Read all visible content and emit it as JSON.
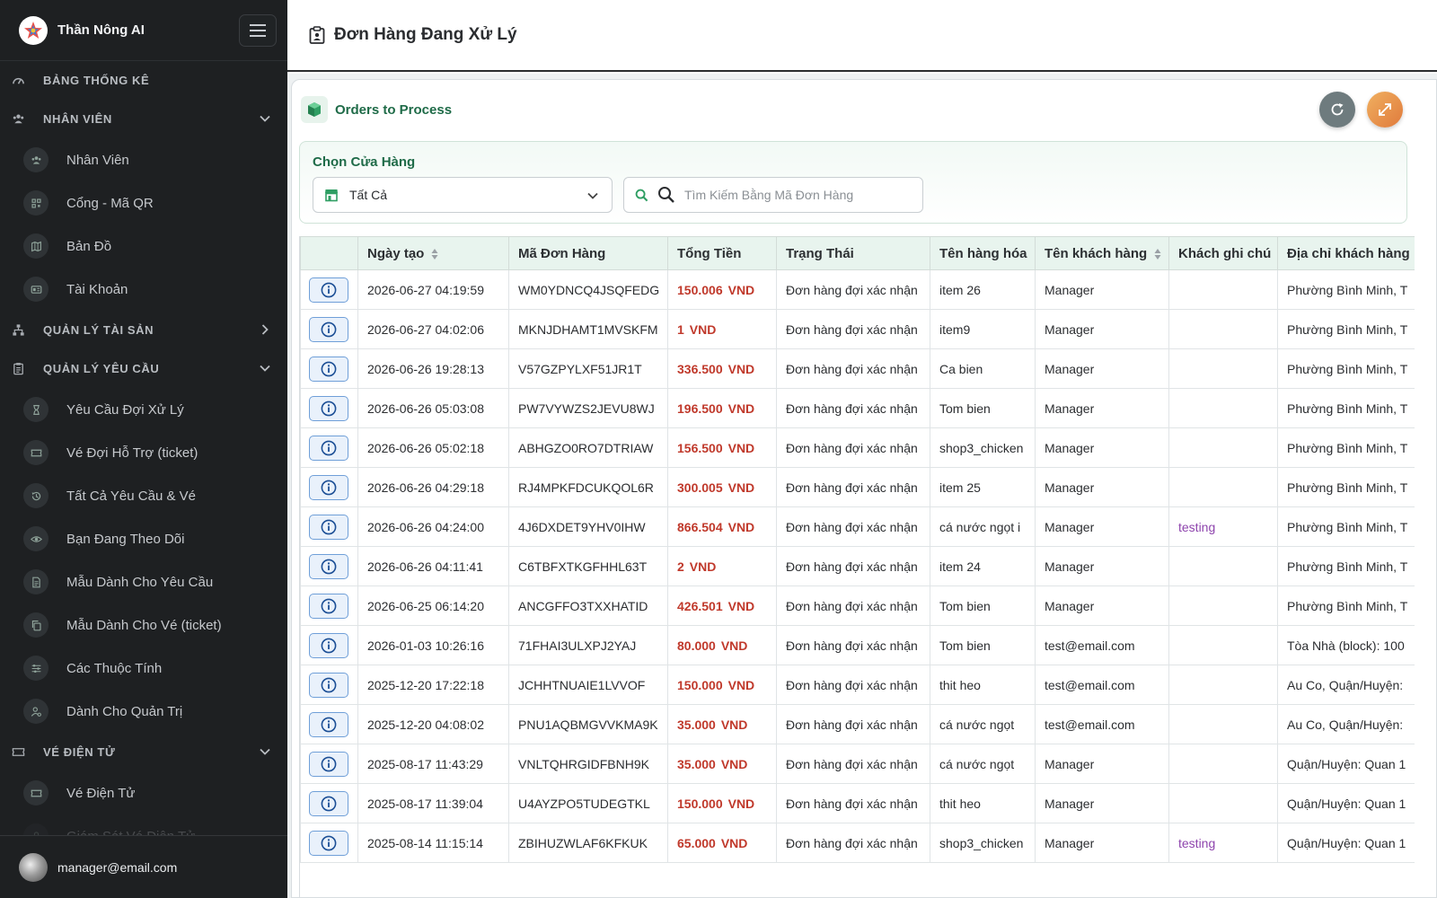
{
  "brand": {
    "name": "Thần Nông AI"
  },
  "sidebar": {
    "sections": [
      {
        "label": "BẢNG THỐNG KÊ",
        "icon": "gauge-icon",
        "chevron": "none",
        "items": []
      },
      {
        "label": "NHÂN VIÊN",
        "icon": "users-icon",
        "chevron": "down",
        "items": [
          {
            "label": "Nhân Viên",
            "icon": "users-icon"
          },
          {
            "label": "Cổng - Mã QR",
            "icon": "qr-icon"
          },
          {
            "label": "Bản Đồ",
            "icon": "map-icon"
          },
          {
            "label": "Tài Khoản",
            "icon": "id-card-icon"
          }
        ]
      },
      {
        "label": "QUẢN LÝ TÀI SẢN",
        "icon": "sitemap-icon",
        "chevron": "right",
        "items": []
      },
      {
        "label": "QUẢN LÝ YÊU CẦU",
        "icon": "clipboard-icon",
        "chevron": "down",
        "items": [
          {
            "label": "Yêu Cầu Đợi Xử Lý",
            "icon": "hourglass-icon"
          },
          {
            "label": "Vé Đợi Hỗ Trợ (ticket)",
            "icon": "ticket-icon"
          },
          {
            "label": "Tất Cả Yêu Cầu & Vé",
            "icon": "history-icon"
          },
          {
            "label": "Bạn Đang Theo Dõi",
            "icon": "eye-icon"
          },
          {
            "label": "Mẫu Dành Cho Yêu Cầu",
            "icon": "file-icon"
          },
          {
            "label": "Mẫu Dành Cho Vé (ticket)",
            "icon": "copy-icon"
          },
          {
            "label": "Các Thuộc Tính",
            "icon": "sliders-icon"
          },
          {
            "label": "Dành Cho Quản Trị",
            "icon": "user-gear-icon"
          }
        ]
      },
      {
        "label": "VÉ ĐIỆN TỬ",
        "icon": "ticket-icon",
        "chevron": "down",
        "items": [
          {
            "label": "Vé Điện Tử",
            "icon": "ticket-icon"
          },
          {
            "label": "Giám Sát Vé Điện Tử",
            "icon": "user-icon"
          }
        ]
      }
    ],
    "user_email": "manager@email.com"
  },
  "header": {
    "title": "Đơn Hàng Đang Xử Lý"
  },
  "card": {
    "title": "Orders to Process",
    "filter_label": "Chọn Cửa Hàng",
    "store_value": "Tất Cả",
    "search_placeholder": "Tìm Kiếm Bằng Mã Đơn Hàng"
  },
  "table": {
    "columns": [
      "",
      "Ngày tạo",
      "Mã Đơn Hàng",
      "Tổng Tiền",
      "Trạng Thái",
      "Tên hàng hóa",
      "Tên khách hàng",
      "Khách ghi chú",
      "Địa chỉ khách hàng"
    ],
    "currency": "VND",
    "rows": [
      {
        "date": "2026-06-27 04:19:59",
        "code": "WM0YDNCQ4JSQFEDG",
        "amount": "150.006",
        "status": "Đơn hàng đợi xác nhận",
        "product": "item 26",
        "customer": "Manager",
        "note": "",
        "address": "Phường Bình Minh, T"
      },
      {
        "date": "2026-06-27 04:02:06",
        "code": "MKNJDHAMT1MVSKFM",
        "amount": "1",
        "status": "Đơn hàng đợi xác nhận",
        "product": "item9",
        "customer": "Manager",
        "note": "",
        "address": "Phường Bình Minh, T"
      },
      {
        "date": "2026-06-26 19:28:13",
        "code": "V57GZPYLXF51JR1T",
        "amount": "336.500",
        "status": "Đơn hàng đợi xác nhận",
        "product": "Ca bien",
        "customer": "Manager",
        "note": "",
        "address": "Phường Bình Minh, T"
      },
      {
        "date": "2026-06-26 05:03:08",
        "code": "PW7VYWZS2JEVU8WJ",
        "amount": "196.500",
        "status": "Đơn hàng đợi xác nhận",
        "product": "Tom bien",
        "customer": "Manager",
        "note": "",
        "address": "Phường Bình Minh, T"
      },
      {
        "date": "2026-06-26 05:02:18",
        "code": "ABHGZO0RO7DTRIAW",
        "amount": "156.500",
        "status": "Đơn hàng đợi xác nhận",
        "product": "shop3_chicken",
        "customer": "Manager",
        "note": "",
        "address": "Phường Bình Minh, T"
      },
      {
        "date": "2026-06-26 04:29:18",
        "code": "RJ4MPKFDCUKQOL6R",
        "amount": "300.005",
        "status": "Đơn hàng đợi xác nhận",
        "product": "item 25",
        "customer": "Manager",
        "note": "",
        "address": "Phường Bình Minh, T"
      },
      {
        "date": "2026-06-26 04:24:00",
        "code": "4J6DXDET9YHV0IHW",
        "amount": "866.504",
        "status": "Đơn hàng đợi xác nhận",
        "product": "cá nước ngọt i",
        "customer": "Manager",
        "note": "testing",
        "address": "Phường Bình Minh, T"
      },
      {
        "date": "2026-06-26 04:11:41",
        "code": "C6TBFXTKGFHHL63T",
        "amount": "2",
        "status": "Đơn hàng đợi xác nhận",
        "product": "item 24",
        "customer": "Manager",
        "note": "",
        "address": "Phường Bình Minh, T"
      },
      {
        "date": "2026-06-25 06:14:20",
        "code": "ANCGFFO3TXXHATID",
        "amount": "426.501",
        "status": "Đơn hàng đợi xác nhận",
        "product": "Tom bien",
        "customer": "Manager",
        "note": "",
        "address": "Phường Bình Minh, T"
      },
      {
        "date": "2026-01-03 10:26:16",
        "code": "71FHAI3ULXPJ2YAJ",
        "amount": "80.000",
        "status": "Đơn hàng đợi xác nhận",
        "product": "Tom bien",
        "customer": "test@email.com",
        "note": "",
        "address": "Tòa Nhà (block): 100"
      },
      {
        "date": "2025-12-20 17:22:18",
        "code": "JCHHTNUAIE1LVVOF",
        "amount": "150.000",
        "status": "Đơn hàng đợi xác nhận",
        "product": "thit heo",
        "customer": "test@email.com",
        "note": "",
        "address": "Au Co, Quận/Huyện:"
      },
      {
        "date": "2025-12-20 04:08:02",
        "code": "PNU1AQBMGVVKMA9K",
        "amount": "35.000",
        "status": "Đơn hàng đợi xác nhận",
        "product": "cá nước ngọt",
        "customer": "test@email.com",
        "note": "",
        "address": "Au Co, Quận/Huyện:"
      },
      {
        "date": "2025-08-17 11:43:29",
        "code": "VNLTQHRGIDFBNH9K",
        "amount": "35.000",
        "status": "Đơn hàng đợi xác nhận",
        "product": "cá nước ngọt",
        "customer": "Manager",
        "note": "",
        "address": "Quận/Huyện: Quan 1"
      },
      {
        "date": "2025-08-17 11:39:04",
        "code": "U4AYZPO5TUDEGTKL",
        "amount": "150.000",
        "status": "Đơn hàng đợi xác nhận",
        "product": "thit heo",
        "customer": "Manager",
        "note": "",
        "address": "Quận/Huyện: Quan 1"
      },
      {
        "date": "2025-08-14 11:15:14",
        "code": "ZBIHUZWLAF6KFKUK",
        "amount": "65.000",
        "status": "Đơn hàng đợi xác nhận",
        "product": "shop3_chicken",
        "customer": "Manager",
        "note": "testing",
        "address": "Quận/Huyện: Quan 1"
      }
    ]
  },
  "colors": {
    "sidebar_bg": "#1e2022",
    "accent_green": "#1f6b48",
    "amount_red": "#c0392b",
    "note_purple": "#8e44ad",
    "header_row": "#e8f4ee"
  }
}
